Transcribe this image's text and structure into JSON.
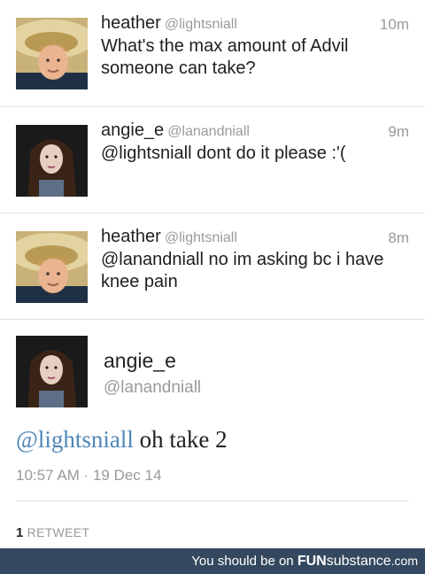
{
  "tweets": [
    {
      "name": "heather",
      "handle": "@lightsniall",
      "time": "10m",
      "text": "What's the max amount of Advil someone can take?",
      "avatar_icon": "blonde-boy-with-hat-avatar"
    },
    {
      "name": "angie_e",
      "handle": "@lanandniall",
      "time": "9m",
      "text": "@lightsniall dont do it please :'(",
      "avatar_icon": "dark-haired-woman-avatar"
    },
    {
      "name": "heather",
      "handle": "@lightsniall",
      "time": "8m",
      "text": "@lanandniall no im asking bc i have knee pain",
      "avatar_icon": "blonde-boy-with-hat-avatar"
    }
  ],
  "detail": {
    "name": "angie_e",
    "handle": "@lanandniall",
    "mention": "@lightsniall",
    "text": " oh take 2",
    "timestamp": "10:57 AM · 19 Dec 14",
    "retweet_count": "1",
    "retweet_label": "RETWEET"
  },
  "footer": {
    "prefix": "You should be on ",
    "brand_bold": "FUN",
    "brand_rest": "substance",
    "suffix": ".com",
    "background": "#34495f"
  },
  "colors": {
    "mention": "#4f86b8",
    "meta_gray": "#9a9a9a"
  }
}
